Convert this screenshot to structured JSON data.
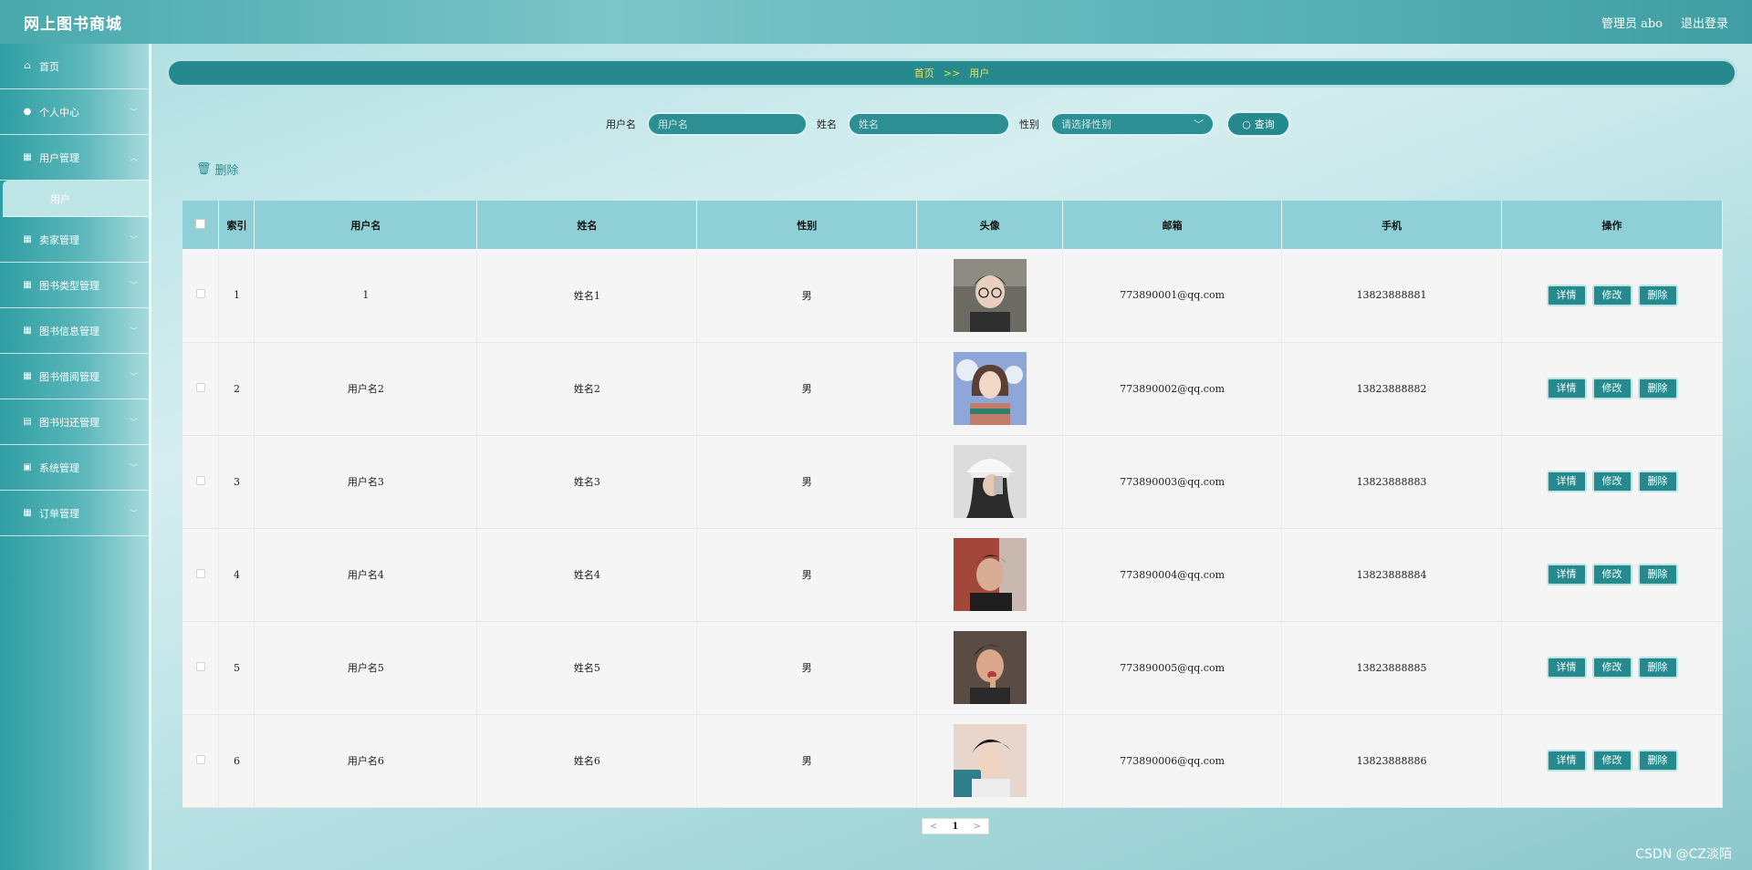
{
  "header": {
    "brand": "网上图书商城",
    "admin_label": "管理员 abo",
    "logout_label": "退出登录"
  },
  "sidebar": {
    "items": [
      {
        "label": "首页",
        "icon": "home-icon"
      },
      {
        "label": "个人中心",
        "icon": "user-icon"
      },
      {
        "label": "用户管理",
        "icon": "grid-icon"
      },
      {
        "label": "卖家管理",
        "icon": "grid-icon"
      },
      {
        "label": "图书类型管理",
        "icon": "grid-icon"
      },
      {
        "label": "图书信息管理",
        "icon": "grid-icon"
      },
      {
        "label": "图书借阅管理",
        "icon": "grid-icon"
      },
      {
        "label": "图书归还管理",
        "icon": "calendar-icon"
      },
      {
        "label": "系统管理",
        "icon": "calendar-check-icon"
      },
      {
        "label": "订单管理",
        "icon": "grid-icon"
      }
    ],
    "sub_item": "用户"
  },
  "breadcrumb": {
    "home": "首页",
    "sep": ">>",
    "current": "用户"
  },
  "search": {
    "username_label": "用户名",
    "username_placeholder": "用户名",
    "name_label": "姓名",
    "name_placeholder": "姓名",
    "gender_label": "性别",
    "gender_placeholder": "请选择性别",
    "query_label": "查询"
  },
  "toolbar": {
    "delete_label": "删除"
  },
  "table": {
    "headers": [
      "索引",
      "用户名",
      "姓名",
      "性别",
      "头像",
      "邮箱",
      "手机",
      "操作"
    ],
    "rows": [
      {
        "index": "1",
        "username": "1",
        "name": "姓名1",
        "gender": "男",
        "email": "773890001@qq.com",
        "phone": "13823888881"
      },
      {
        "index": "2",
        "username": "用户名2",
        "name": "姓名2",
        "gender": "男",
        "email": "773890002@qq.com",
        "phone": "13823888882"
      },
      {
        "index": "3",
        "username": "用户名3",
        "name": "姓名3",
        "gender": "男",
        "email": "773890003@qq.com",
        "phone": "13823888883"
      },
      {
        "index": "4",
        "username": "用户名4",
        "name": "姓名4",
        "gender": "男",
        "email": "773890004@qq.com",
        "phone": "13823888884"
      },
      {
        "index": "5",
        "username": "用户名5",
        "name": "姓名5",
        "gender": "男",
        "email": "773890005@qq.com",
        "phone": "13823888885"
      },
      {
        "index": "6",
        "username": "用户名6",
        "name": "姓名6",
        "gender": "男",
        "email": "773890006@qq.com",
        "phone": "13823888886"
      }
    ],
    "actions": {
      "detail": "详情",
      "edit": "修改",
      "delete": "删除"
    }
  },
  "pagination": {
    "prev": "<",
    "current": "1",
    "next": ">"
  },
  "watermark": "CSDN @CZ淡陌",
  "colors": {
    "accent": "#26898d",
    "breadcrumb_text": "#f5e14a",
    "header_bg": "#8fd0d6"
  }
}
